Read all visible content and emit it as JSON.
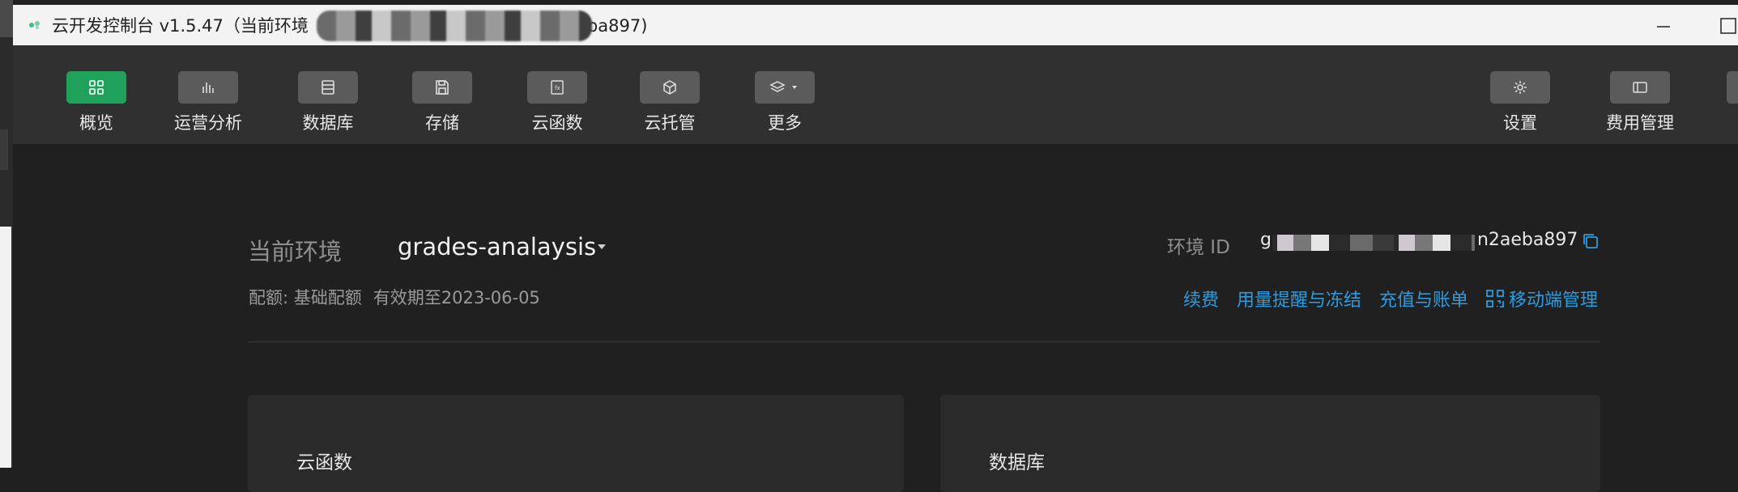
{
  "window": {
    "title": "云开发控制台 v1.5.47（当前环境",
    "title_suffix": "ba897)",
    "app_icon": "cloud-dev-logo-icon"
  },
  "toolbar": {
    "items": [
      {
        "label": "概览",
        "icon": "grid-icon",
        "active": true
      },
      {
        "label": "运营分析",
        "icon": "bar-chart-icon"
      },
      {
        "label": "数据库",
        "icon": "database-icon"
      },
      {
        "label": "存储",
        "icon": "save-icon"
      },
      {
        "label": "云函数",
        "icon": "function-icon"
      },
      {
        "label": "云托管",
        "icon": "cube-icon"
      },
      {
        "label": "更多",
        "icon": "layers-icon"
      }
    ],
    "right_items": [
      {
        "label": "设置",
        "icon": "gear-icon"
      },
      {
        "label": "费用管理",
        "icon": "billing-icon"
      }
    ],
    "accent_color": "#1fa15c"
  },
  "env": {
    "label": "当前环境",
    "name": "grades-analaysis",
    "quota_label": "配额: 基础配额",
    "valid_until": "有效期至2023-06-05",
    "id_label": "环境 ID",
    "id_prefix": "g",
    "id_suffix": "n2aeba897"
  },
  "links": {
    "renew": "续费",
    "usage_alert": "用量提醒与冻结",
    "recharge": "充值与账单",
    "mobile": "移动端管理",
    "color": "#2c9bdf"
  },
  "cards": [
    {
      "title": "云函数"
    },
    {
      "title": "数据库"
    }
  ]
}
